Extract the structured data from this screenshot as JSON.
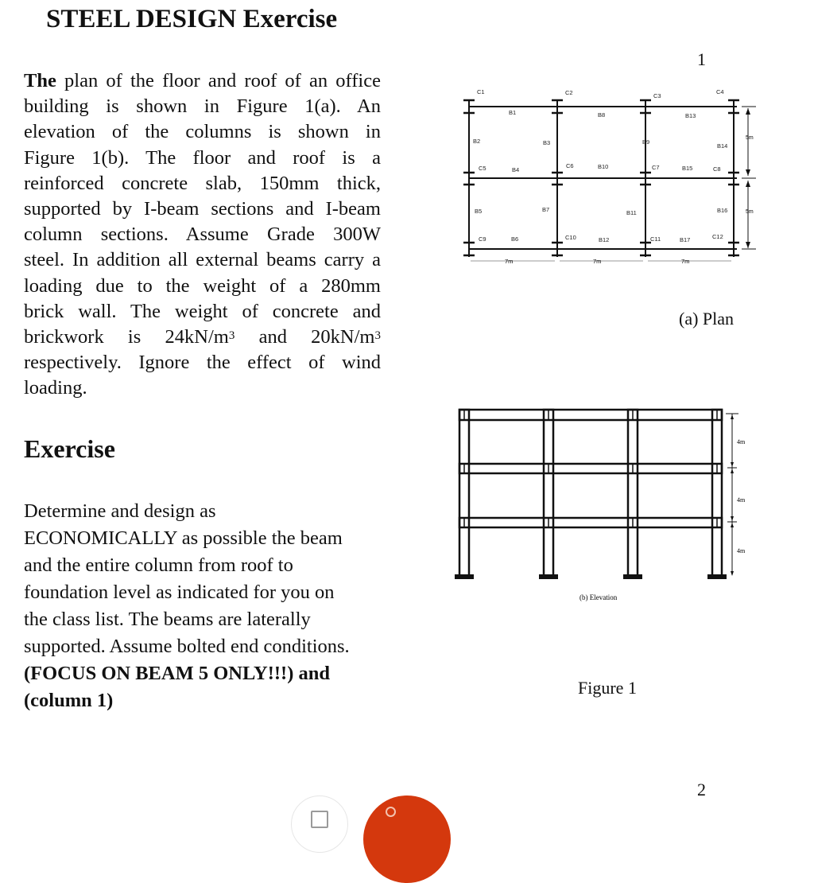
{
  "document": {
    "title": "STEEL DESIGN Exercise",
    "page_number_top": "1",
    "page_number_bottom": "2",
    "intro_lines": [
      {
        "bold": "The",
        "text": " plan of the floor and roof of an office"
      },
      {
        "text": "building is shown in Figure 1(a). An"
      },
      {
        "text": "elevation of the columns is shown in"
      },
      {
        "text": "Figure 1(b). The floor and roof is a"
      },
      {
        "text": "reinforced concrete slab, 150mm thick,"
      },
      {
        "text": "supported by I-beam sections and I-beam"
      },
      {
        "text": "column sections. Assume Grade 300W"
      },
      {
        "text": "steel. In addition all external beams carry a"
      },
      {
        "text": "loading due to the weight of a 280mm"
      },
      {
        "pre": "brick wall. The weight of concrete and"
      },
      {
        "a": "brickwork is 24kN/m",
        "sup1": "3",
        "b": " and 20kN/m",
        "sup2": "3"
      },
      {
        "text": "respectively. Ignore the effect of wind"
      },
      {
        "text": "loading."
      }
    ],
    "exercise_heading": "Exercise",
    "task_lines": [
      "Determine and design as",
      "ECONOMICALLY as possible the beam",
      "and the entire column from roof to",
      "foundation level as indicated for you on",
      "the class list.  The beams are laterally",
      "supported. Assume bolted end conditions."
    ],
    "task_bold_lines": [
      "(FOCUS ON BEAM 5 ONLY!!!) and",
      "(column 1)"
    ]
  },
  "plan_figure": {
    "caption": "(a) Plan",
    "columns": [
      "C1",
      "C2",
      "C3",
      "C4",
      "C5",
      "C6",
      "C7",
      "C8",
      "C9",
      "C10",
      "C11",
      "C12"
    ],
    "beams": [
      "B1",
      "B2",
      "B3",
      "B4",
      "B5",
      "B6",
      "B7",
      "B8",
      "B9",
      "B10",
      "B11",
      "B12",
      "B13",
      "B14",
      "B15",
      "B16",
      "B17"
    ],
    "span_labels": [
      "7m",
      "7m",
      "7m"
    ],
    "bay_labels": [
      "5m",
      "5m"
    ]
  },
  "elevation_figure": {
    "caption": "(b) Elevation",
    "storey_heights": [
      "4m",
      "4m",
      "4m"
    ]
  },
  "figure_caption": "Figure 1",
  "overlay_buttons": {
    "left_icon": "square-icon",
    "right_color": "#d4380d"
  }
}
